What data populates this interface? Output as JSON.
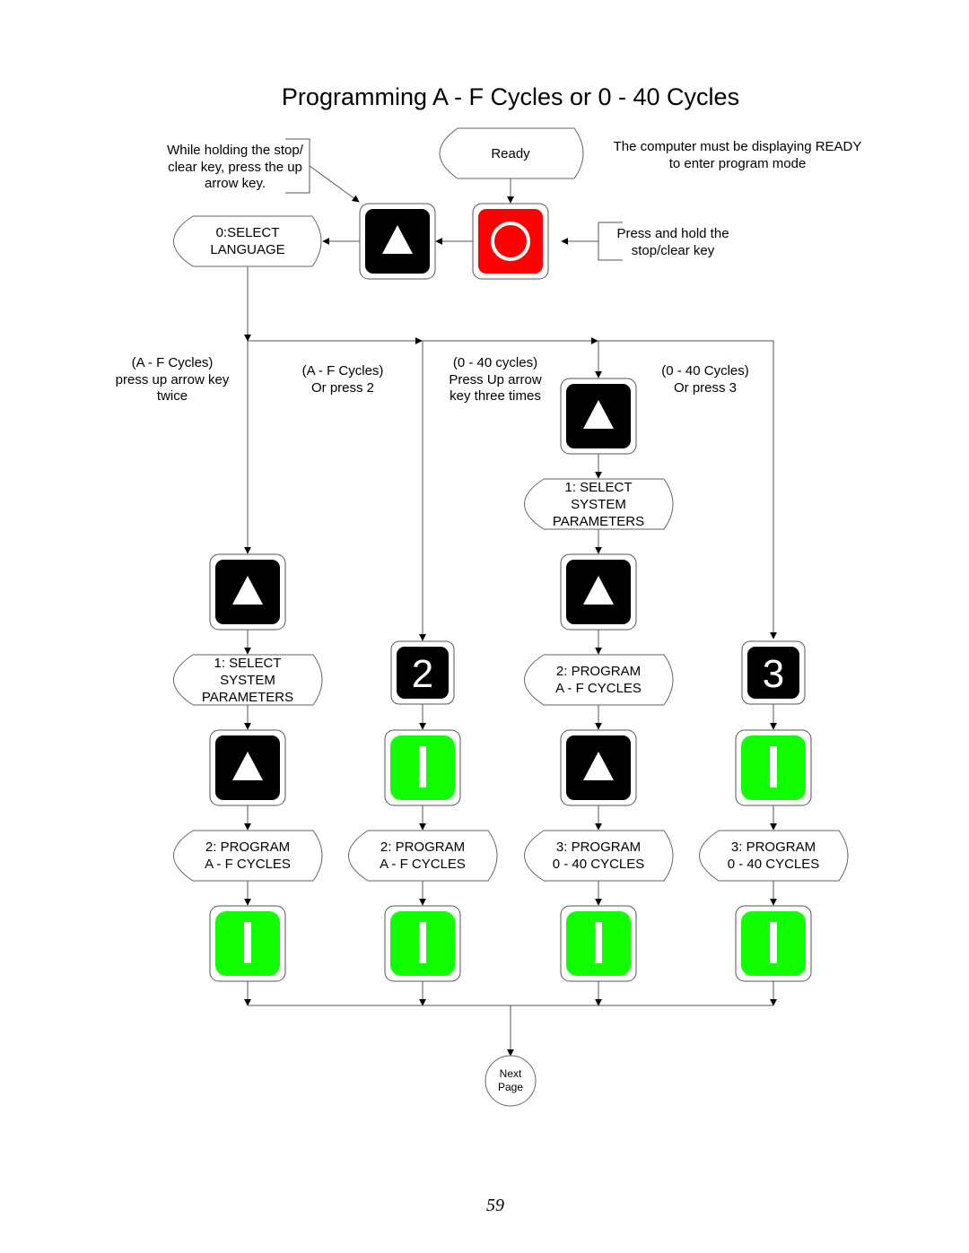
{
  "page": {
    "title": "Programming A - F Cycles or 0 - 40 Cycles",
    "page_number": "59"
  },
  "colors": {
    "key_black": "#000000",
    "key_red": "#ff0000",
    "key_green": "#11ff00",
    "line": "#555555"
  },
  "notes": {
    "hold_up": [
      "While holding the stop/",
      "clear key, press the up",
      "arrow key."
    ],
    "must_ready": [
      "The computer must be displaying READY",
      "to enter program mode"
    ],
    "press_hold": [
      "Press and hold the",
      "stop/clear key"
    ],
    "col1": [
      "(A - F Cycles)",
      "press up arrow key",
      "twice"
    ],
    "col2": [
      "(A - F Cycles)",
      "Or press 2"
    ],
    "col3": [
      "(0 - 40 cycles)",
      "Press Up arrow",
      "key three times"
    ],
    "col4": [
      "(0 - 40 Cycles)",
      "Or press 3"
    ]
  },
  "displays": {
    "ready": [
      "Ready"
    ],
    "select_language": [
      "0:SELECT",
      "LANGUAGE"
    ],
    "select_system_col3": [
      "1: SELECT",
      "SYSTEM",
      "PARAMETERS"
    ],
    "select_system_col1": [
      "1: SELECT",
      "SYSTEM",
      "PARAMETERS"
    ],
    "program_af_col3": [
      "2: PROGRAM",
      "A - F CYCLES"
    ],
    "program_af_col1": [
      "2: PROGRAM",
      "A - F CYCLES"
    ],
    "program_af_col2": [
      "2: PROGRAM",
      "A - F CYCLES"
    ],
    "program_040_col3": [
      "3: PROGRAM",
      "0 - 40 CYCLES"
    ],
    "program_040_col4": [
      "3: PROGRAM",
      "0 - 40 CYCLES"
    ]
  },
  "keys": {
    "up_arrow": "up-arrow",
    "stop_clear": "stop-clear",
    "enter": "enter",
    "digit_2": "2",
    "digit_3": "3"
  },
  "connector": [
    "Next",
    "Page"
  ]
}
